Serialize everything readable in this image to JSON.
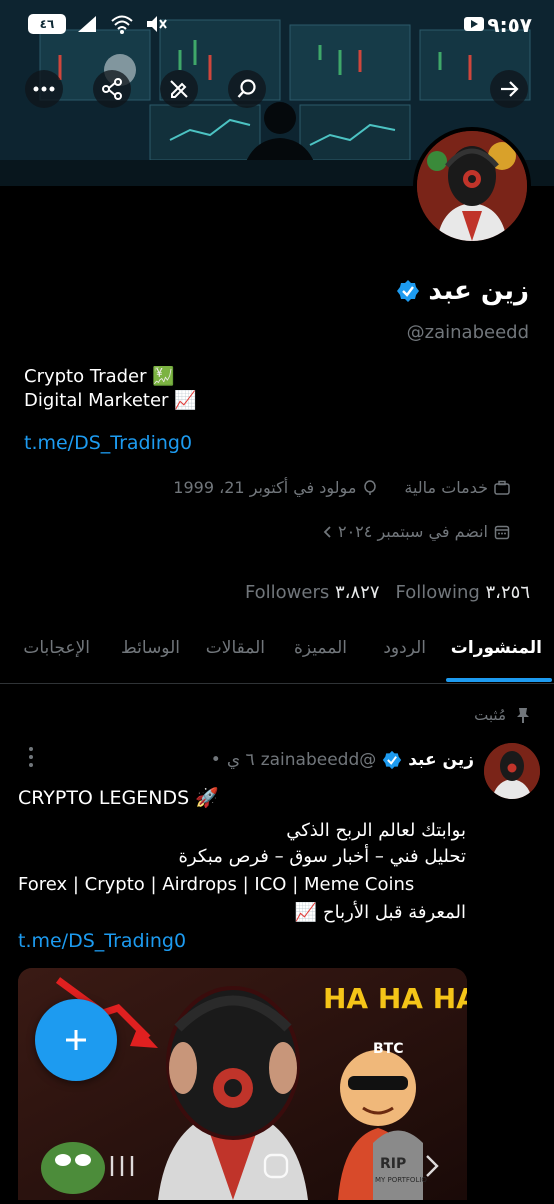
{
  "status_bar": {
    "time": "٩:٥٧",
    "battery": "٤٦"
  },
  "profile": {
    "name": "زين عبد",
    "handle": "@zainabeedd",
    "bio_line1": "Crypto Trader 💹",
    "bio_line2": "Digital Marketer 📈",
    "link": "t.me/DS_Trading0",
    "category": "خدمات مالية",
    "birthday": "مولود في أكتوبر 21، 1999",
    "joined": "انضم في سبتمبر ٢٠٢٤",
    "following_count": "٣،٢٥٦",
    "following_label": "Following",
    "followers_count": "٣،٨٢٧",
    "followers_label": "Followers"
  },
  "tabs": [
    {
      "label": "المنشورات",
      "active": true
    },
    {
      "label": "الردود"
    },
    {
      "label": "المميزة"
    },
    {
      "label": "المقالات"
    },
    {
      "label": "الوسائط"
    },
    {
      "label": "الإعجابات"
    }
  ],
  "post": {
    "pinned_label": "مُثبت",
    "name": "زين عبد",
    "handle": "@zainabeedd",
    "time": "٦ ي",
    "title": "CRYPTO LEGENDS 🚀",
    "line1": "بوابتك لعالم الربح الذكي",
    "line2": "تحليل فني – أخبار سوق – فرص مبكرة",
    "line3": "Forex | Crypto | Airdrops | ICO | Meme Coins",
    "line4": "المعرفة قبل الأرباح 📈",
    "link": "t.me/DS_Trading0",
    "image_text": {
      "haha": "HA HA HA!",
      "btc": "BTC",
      "rip": "RIP",
      "portfolio": "MY PORTFOLIO"
    }
  },
  "colors": {
    "accent": "#1d9bf0",
    "muted": "#71767b",
    "background": "#000000"
  }
}
